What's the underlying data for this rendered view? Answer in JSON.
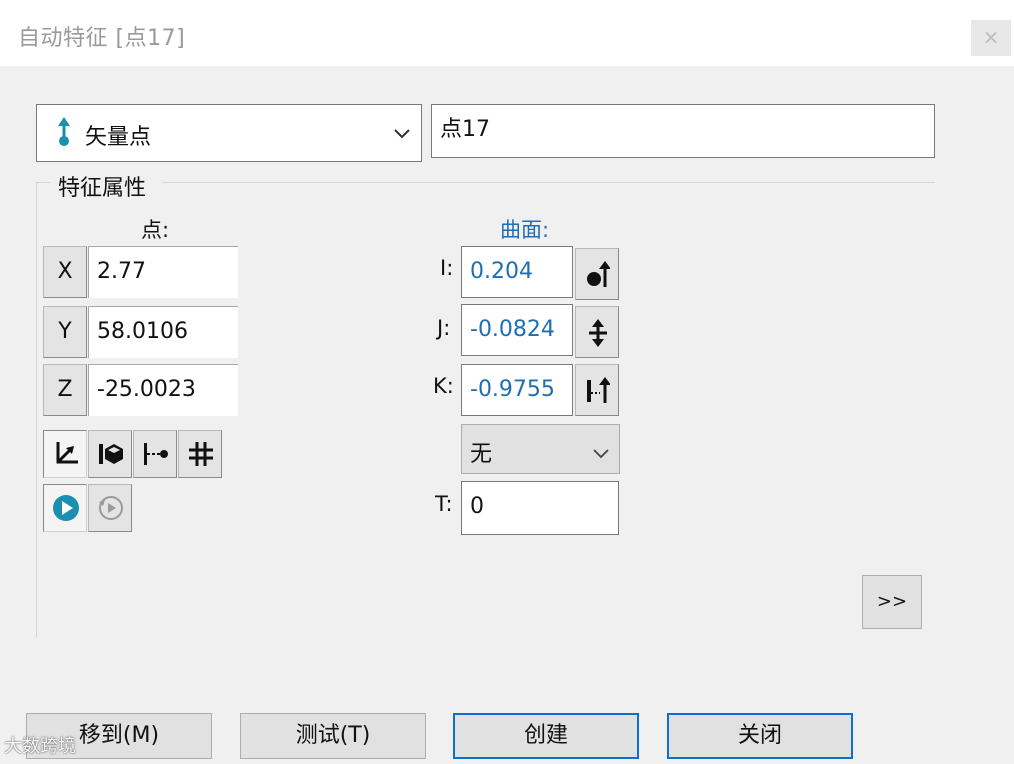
{
  "window": {
    "title": "自动特征 [点17]",
    "close_label": "×"
  },
  "feature_type": {
    "selected": "矢量点",
    "icon": "vector-point-icon"
  },
  "feature_name": "点17",
  "properties": {
    "group_title": "特征属性",
    "point_label": "点:",
    "surface_label": "曲面:",
    "x": {
      "label": "X",
      "value": "2.77"
    },
    "y": {
      "label": "Y",
      "value": "58.0106"
    },
    "z": {
      "label": "Z",
      "value": "-25.0023"
    },
    "i": {
      "label": "I:",
      "value": "0.204"
    },
    "j": {
      "label": "J:",
      "value": "-0.0824"
    },
    "k": {
      "label": "K:",
      "value": "-0.9755"
    },
    "mode_select": "无",
    "t": {
      "label": "T:",
      "value": "0"
    }
  },
  "toolbar_icons": [
    "coordinate-axes-icon",
    "probe-surface-icon",
    "point-distance-icon",
    "grid-icon",
    "play-icon",
    "replay-icon"
  ],
  "side_icons": [
    "surface-normal-icon",
    "flip-vector-icon",
    "find-vector-icon"
  ],
  "more_button": ">>",
  "buttons": {
    "move_to": "移到(M)",
    "test": "测试(T)",
    "create": "创建",
    "close": "关闭"
  },
  "watermark": "大数跨境",
  "colors": {
    "accent_blue": "#1e6eb4",
    "primary_border": "#0f6fd1",
    "icon_teal": "#1a8fb0"
  }
}
